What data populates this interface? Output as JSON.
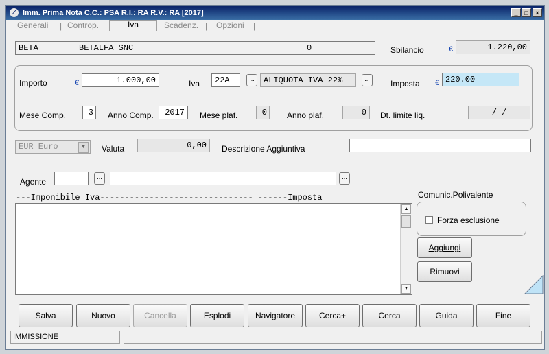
{
  "window": {
    "title": "Imm. Prima Nota C.C.: PSA  R.I.: RA  R.V.: RA  [2017]",
    "minimize": "_",
    "maximize": "□",
    "close": "×"
  },
  "tabs": {
    "generali": "Generali",
    "controp": "Controp.",
    "iva": "Iva",
    "scadenz": "Scadenz.",
    "opzioni": "Opzioni",
    "sep": "|"
  },
  "header": {
    "code": "BETA",
    "company": "BETALFA SNC",
    "zero": "0",
    "sbilancio_label": "Sbilancio",
    "currency": "€",
    "sbilancio_value": "1.220,00"
  },
  "iva_group": {
    "importo_label": "Importo",
    "importo_value": "1.000,00",
    "iva_label": "Iva",
    "iva_code": "22A",
    "iva_desc": "ALIQUOTA IVA 22%",
    "imposta_label": "Imposta",
    "imposta_value": "220.00",
    "mese_comp_label": "Mese Comp.",
    "mese_comp_value": "3",
    "anno_comp_label": "Anno Comp.",
    "anno_comp_value": "2017",
    "mese_plaf_label": "Mese plaf.",
    "mese_plaf_value": "0",
    "anno_plaf_label": "Anno plaf.",
    "anno_plaf_value": "0",
    "dt_limite_label": "Dt. limite liq.",
    "dt_limite_value": "/   /"
  },
  "valuta": {
    "select_value": "EUR Euro",
    "label": "Valuta",
    "amount": "0,00",
    "descr_label": "Descrizione Aggiuntiva",
    "descr_value": ""
  },
  "agente": {
    "label": "Agente",
    "code": "",
    "name": ""
  },
  "list": {
    "header": "---Imponibile Iva------------------------------- ------Imposta"
  },
  "comunic": {
    "label": "Comunic.Polivalente",
    "forza": "Forza esclusione"
  },
  "side_buttons": {
    "aggiungi": "Aggiungi",
    "rimuovi": "Rimuovi"
  },
  "ellipsis": "...",
  "toolbar": {
    "salva": "Salva",
    "nuovo": "Nuovo",
    "cancella": "Cancella",
    "esplodi": "Esplodi",
    "navigatore": "Navigatore",
    "cercaplus": "Cerca+",
    "cerca": "Cerca",
    "guida": "Guida",
    "fine": "Fine"
  },
  "status": {
    "mode": "IMMISSIONE",
    "message": ""
  }
}
